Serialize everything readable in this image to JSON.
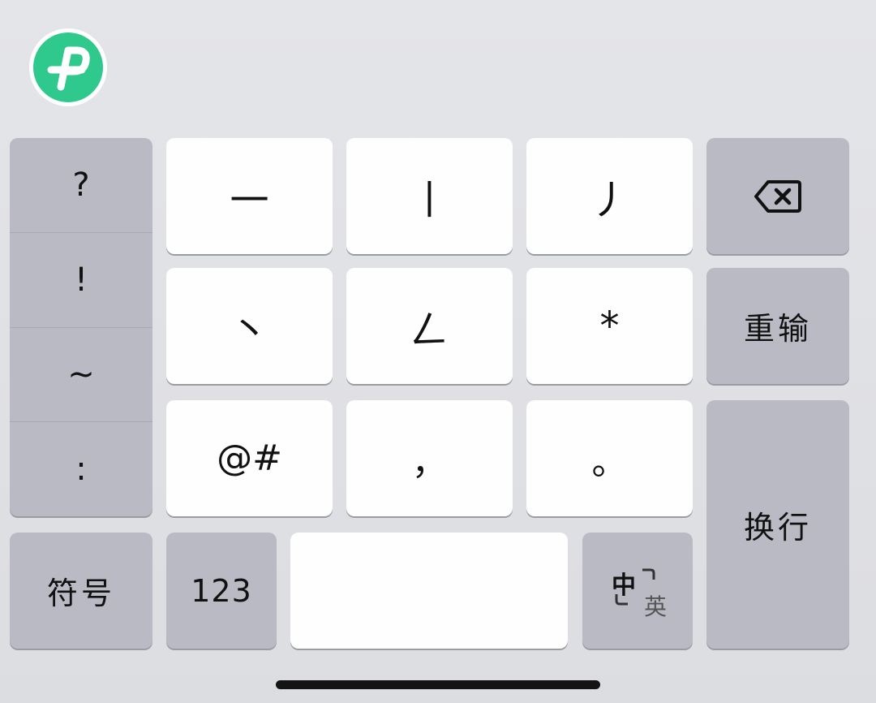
{
  "app": {
    "logo_icon": "paperclip-p-logo-icon",
    "brand_color": "#2fc98d"
  },
  "symbols_column": [
    "?",
    "!",
    "~",
    ":"
  ],
  "stroke_keys": {
    "row1": [
      "一",
      "丨",
      "丿"
    ],
    "row2": [
      "丶",
      "𠃋",
      "*"
    ],
    "row3": [
      "@#",
      "，",
      "。"
    ]
  },
  "function_keys": {
    "backspace_icon": "backspace-icon",
    "reenter": "重输",
    "enter": "换行",
    "symbols": "符号",
    "numbers": "123",
    "space": "",
    "lang_primary": "中",
    "lang_secondary": "英"
  }
}
